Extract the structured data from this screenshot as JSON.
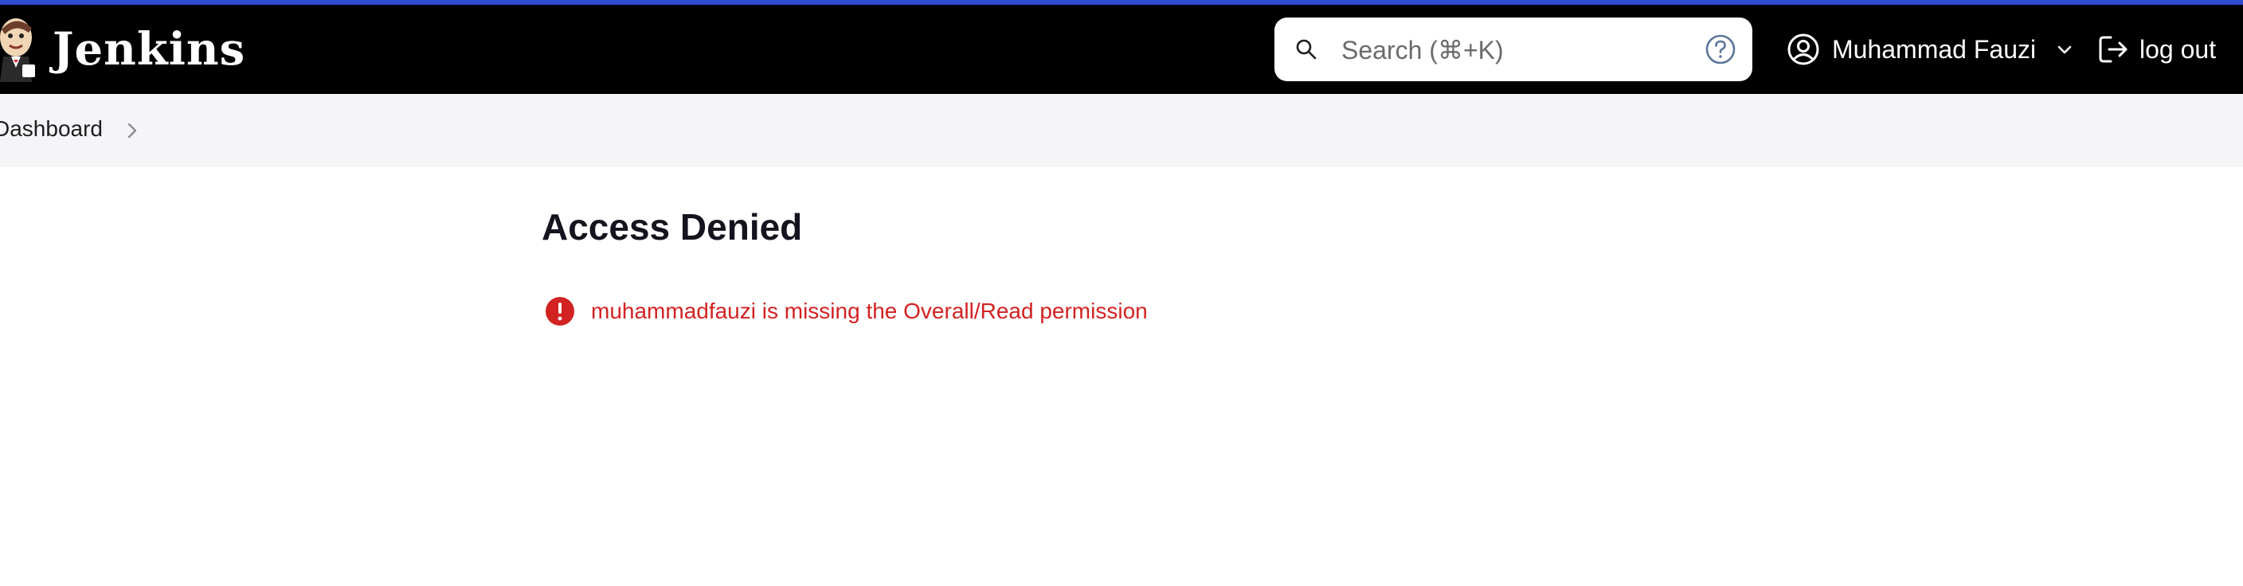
{
  "header": {
    "logo_text": "Jenkins",
    "search": {
      "placeholder": "Search (⌘+K)",
      "value": ""
    },
    "user_name": "Muhammad Fauzi",
    "logout_label": "log out"
  },
  "breadcrumb": {
    "items": [
      {
        "label": "Dashboard"
      }
    ]
  },
  "main": {
    "title": "Access Denied",
    "error_message": "muhammadfauzi is missing the Overall/Read permission"
  },
  "colors": {
    "accent_bar": "#2e4ad1",
    "header_bg": "#000000",
    "breadcrumb_bg": "#f5f5f7",
    "error": "#d32222",
    "help_icon": "#5a7699"
  },
  "icons": {
    "logo": "jenkins-butler-icon",
    "search": "search-icon",
    "help": "help-icon",
    "user": "user-circle-icon",
    "dropdown": "chevron-down-icon",
    "logout": "logout-icon",
    "breadcrumb_separator": "chevron-right-icon",
    "error": "error-circle-icon"
  }
}
